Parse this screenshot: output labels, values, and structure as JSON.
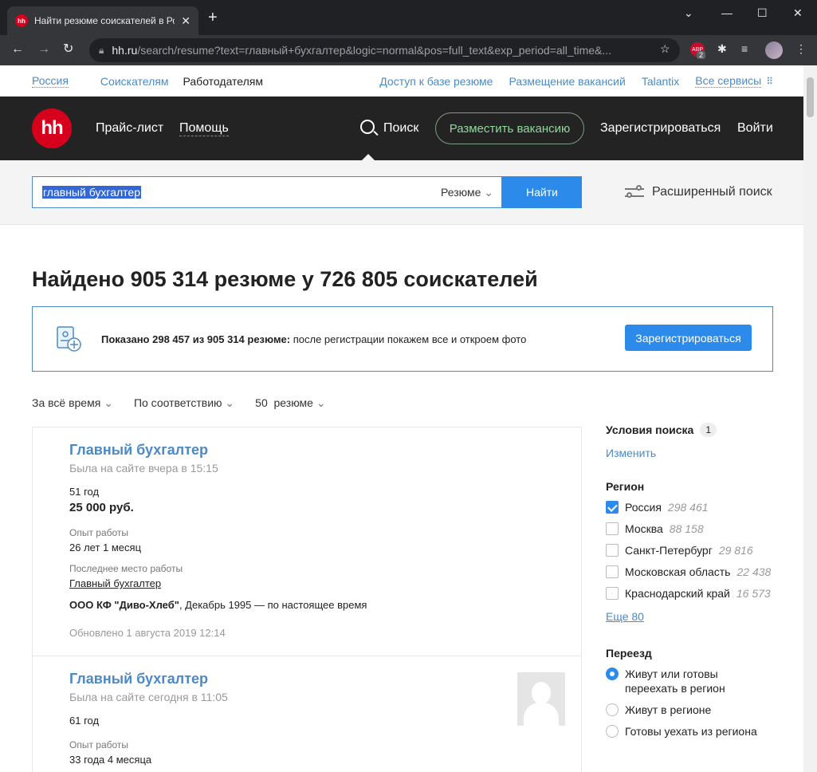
{
  "browser": {
    "tab_title": "Найти резюме соискателей в Ро",
    "tab_favicon": "hh",
    "url_host": "hh.ru",
    "url_rest": "/search/resume?text=главный+бухгалтер&logic=normal&pos=full_text&exp_period=all_time&...",
    "abp_label": "ABP",
    "abp_badge": "2"
  },
  "topnav": {
    "region": "Россия",
    "seekers": "Соискателям",
    "employers": "Работодателям",
    "db_access": "Доступ к базе резюме",
    "post_vacancies": "Размещение вакансий",
    "talantix": "Talantix",
    "all_services": "Все сервисы"
  },
  "header": {
    "logo": "hh",
    "price": "Прайс-лист",
    "help": "Помощь",
    "search": "Поиск",
    "post_vacancy": "Разместить вакансию",
    "register": "Зарегистрироваться",
    "login": "Войти"
  },
  "search": {
    "query": "главный бухгалтер",
    "type": "Резюме",
    "find": "Найти",
    "advanced": "Расширенный поиск"
  },
  "results": {
    "title": "Найдено 905 314 резюме у 726 805 соискателей",
    "banner_bold": "Показано 298 457 из 905 314 резюме:",
    "banner_text": " после регистрации покажем все и откроем фото",
    "banner_button": "Зарегистрироваться",
    "filter_time": "За всё время",
    "filter_sort": "По соответствию",
    "filter_count": "50  резюме"
  },
  "cards": [
    {
      "title": "Главный бухгалтер",
      "seen": "Была на сайте вчера в 15:15",
      "age": "51 год",
      "salary": "25 000 руб.",
      "exp_label": "Опыт работы",
      "exp": "26 лет 1 месяц",
      "last_label": "Последнее место работы",
      "last": "Главный бухгалтер",
      "company": "ООО КФ \"Диво-Хлеб\"",
      "period": ", Декабрь 1995 — по настоящее время",
      "updated": "Обновлено 1 августа 2019 12:14"
    },
    {
      "title": "Главный бухгалтер",
      "seen": "Была на сайте сегодня в 11:05",
      "age": "61 год",
      "exp_label": "Опыт работы",
      "exp": "33 года 4 месяца"
    }
  ],
  "sidebar": {
    "conditions": "Условия поиска",
    "conditions_count": "1",
    "change": "Изменить",
    "region": "Регион",
    "regions": [
      {
        "name": "Россия",
        "count": "298 461",
        "checked": true
      },
      {
        "name": "Москва",
        "count": "88 158",
        "checked": false
      },
      {
        "name": "Санкт-Петербург",
        "count": "29 816",
        "checked": false
      },
      {
        "name": "Московская область",
        "count": "22 438",
        "checked": false
      },
      {
        "name": "Краснодарский край",
        "count": "16 573",
        "checked": false
      }
    ],
    "more": "Еще 80",
    "relocation": "Переезд",
    "reloc_options": [
      {
        "name": "Живут или готовы переехать в регион",
        "checked": true
      },
      {
        "name": "Живут в регионе",
        "checked": false
      },
      {
        "name": "Готовы уехать из региона",
        "checked": false
      }
    ]
  },
  "colors": {
    "brand": "#d6001c",
    "accent": "#2c8bea",
    "link": "#4c8ac6",
    "header_bg": "#232323"
  }
}
